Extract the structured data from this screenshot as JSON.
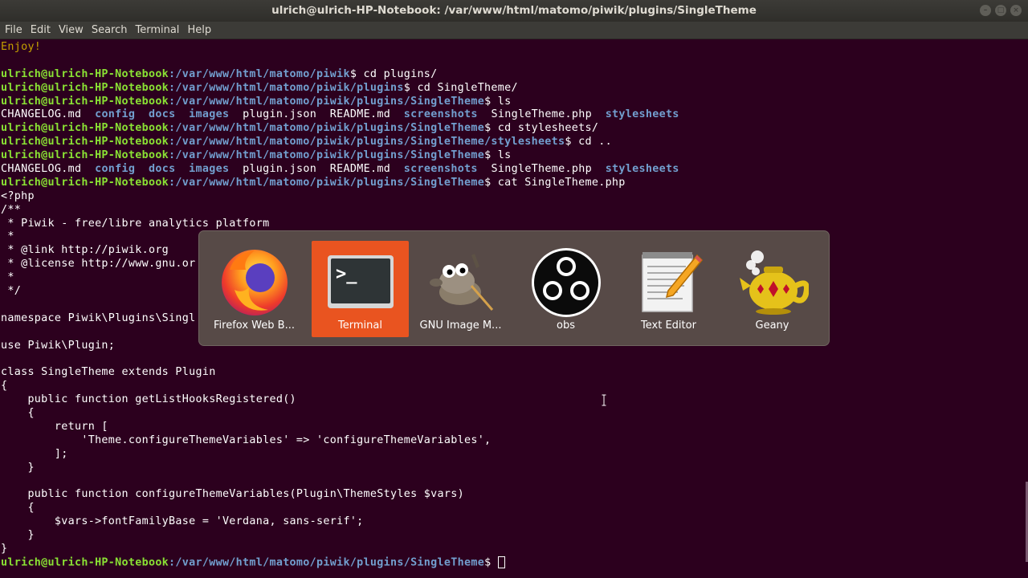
{
  "window": {
    "title": "ulrich@ulrich-HP-Notebook: /var/www/html/matomo/piwik/plugins/SingleTheme",
    "buttons": [
      "–",
      "□",
      "×"
    ]
  },
  "menu": [
    "File",
    "Edit",
    "View",
    "Search",
    "Terminal",
    "Help"
  ],
  "terminal": {
    "user": "ulrich@ulrich-HP-Notebook",
    "lines": {
      "l0": "Enjoy!",
      "l1": "",
      "l2_path": ":/var/www/html/matomo/piwik",
      "l2_cmd": "$ cd plugins/",
      "l3_path": ":/var/www/html/matomo/piwik/plugins",
      "l3_cmd": "$ cd SingleTheme/",
      "l4_path": ":/var/www/html/matomo/piwik/plugins/SingleTheme",
      "l4_cmd": "$ ls",
      "ls": {
        "f1": "CHANGELOG.md",
        "d1": "config",
        "d2": "docs",
        "d3": "images",
        "f2": "plugin.json",
        "f3": "README.md",
        "d4": "screenshots",
        "f4": "SingleTheme.php",
        "d5": "stylesheets"
      },
      "l6_path": ":/var/www/html/matomo/piwik/plugins/SingleTheme",
      "l6_cmd": "$ cd stylesheets/",
      "l7_path": ":/var/www/html/matomo/piwik/plugins/SingleTheme/stylesheets",
      "l7_cmd": "$ cd ..",
      "l8_path": ":/var/www/html/matomo/piwik/plugins/SingleTheme",
      "l8_cmd": "$ ls",
      "l10_path": ":/var/www/html/matomo/piwik/plugins/SingleTheme",
      "l10_cmd": "$ cat SingleTheme.php",
      "c1": "<?php",
      "c2": "/**",
      "c3": " * Piwik - free/libre analytics platform",
      "c4": " *",
      "c5": " * @link http://piwik.org",
      "c6": " * @license http://www.gnu.or",
      "c7": " *",
      "c8": " */",
      "c9": "",
      "c10": "namespace Piwik\\Plugins\\Singl",
      "c11": "",
      "c12": "use Piwik\\Plugin;",
      "c13": "",
      "c14": "class SingleTheme extends Plugin",
      "c15": "{",
      "c16": "    public function getListHooksRegistered()",
      "c17": "    {",
      "c18": "        return [",
      "c19": "            'Theme.configureThemeVariables' => 'configureThemeVariables',",
      "c20": "        ];",
      "c21": "    }",
      "c22": "",
      "c23": "    public function configureThemeVariables(Plugin\\ThemeStyles $vars)",
      "c24": "    {",
      "c25": "        $vars->fontFamilyBase = 'Verdana, sans-serif';",
      "c26": "    }",
      "c27": "}",
      "last_path": ":/var/www/html/matomo/piwik/plugins/SingleTheme",
      "last_cmd": "$ "
    }
  },
  "switcher": {
    "apps": [
      {
        "label": "Firefox Web B...",
        "icon": "firefox-icon"
      },
      {
        "label": "Terminal",
        "icon": "terminal-icon",
        "selected": true
      },
      {
        "label": "GNU Image M...",
        "icon": "gimp-icon"
      },
      {
        "label": "obs",
        "icon": "obs-icon"
      },
      {
        "label": "Text Editor",
        "icon": "text-editor-icon"
      },
      {
        "label": "Geany",
        "icon": "geany-icon"
      }
    ]
  },
  "colors": {
    "background": "#2c001e",
    "prompt_user": "#8ae234",
    "prompt_path": "#729fcf",
    "selected_app": "#e95420"
  }
}
